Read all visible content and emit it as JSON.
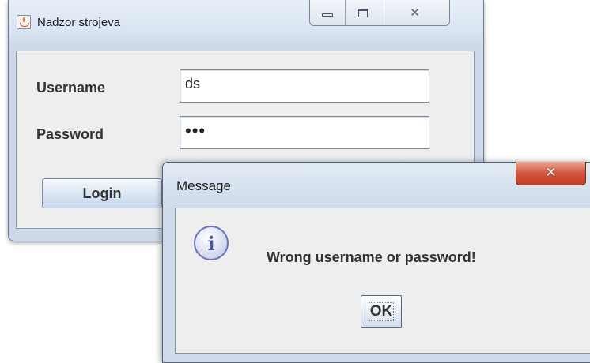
{
  "login_window": {
    "title": "Nadzor strojeva",
    "caption_buttons": {
      "minimize_icon": "minimize-icon",
      "maximize_icon": "maximize-icon",
      "close_icon": "close-icon"
    },
    "username_label": "Username",
    "username_value": "ds",
    "password_label": "Password",
    "password_value": "•••",
    "login_button": "Login"
  },
  "message_dialog": {
    "title": "Message",
    "close_icon": "close-icon",
    "icon": "info-icon",
    "icon_glyph": "i",
    "message": "Wrong username or password!",
    "ok_button": "OK"
  },
  "colors": {
    "dialog_close_red": "#c23e27",
    "info_icon_blue": "#4b55a3"
  }
}
